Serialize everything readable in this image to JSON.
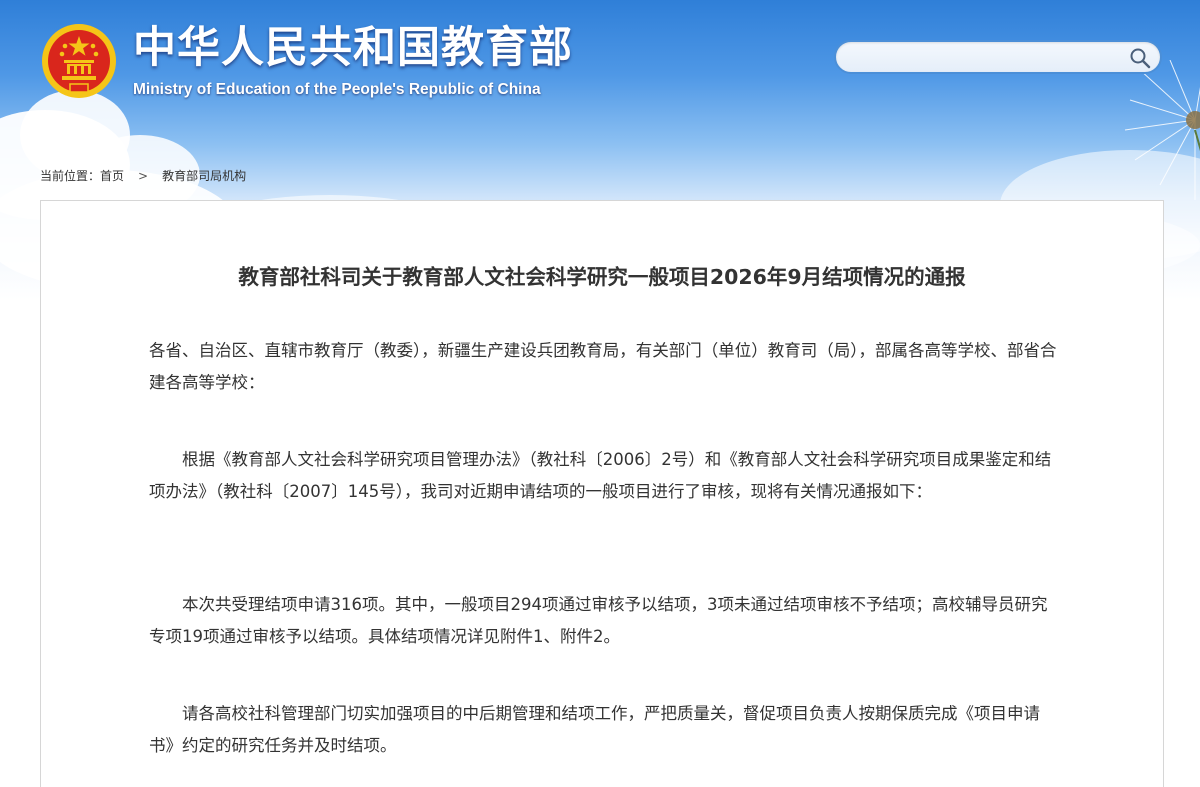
{
  "header": {
    "title": "中华人民共和国教育部",
    "subtitle": "Ministry of Education of the People's Republic of China",
    "emblem_icon": "national-emblem-icon",
    "search": {
      "value": "",
      "placeholder": "",
      "icon": "search-icon"
    }
  },
  "breadcrumb": {
    "prefix": "当前位置：",
    "home": "首页",
    "separator": ">",
    "current": "教育部司局机构"
  },
  "article": {
    "title": "教育部社科司关于教育部人文社会科学研究一般项目2026年9月结项情况的通报",
    "paragraphs": [
      "各省、自治区、直辖市教育厅（教委），新疆生产建设兵团教育局，有关部门（单位）教育司（局），部属各高等学校、部省合建各高等学校：",
      "根据《教育部人文社会科学研究项目管理办法》（教社科〔2006〕2号）和《教育部人文社会科学研究项目成果鉴定和结项办法》（教社科〔2007〕145号），我司对近期申请结项的一般项目进行了审核，现将有关情况通报如下：",
      "本次共受理结项申请316项。其中，一般项目294项通过审核予以结项，3项未通过结项审核不予结项；高校辅导员研究专项19项通过审核予以结项。具体结项情况详见附件1、附件2。",
      "请各高校社科管理部门切实加强项目的中后期管理和结项工作，严把质量关，督促项目负责人按期保质完成《项目申请书》约定的研究任务并及时结项。"
    ]
  },
  "colors": {
    "header_blue": "#2f7fd8",
    "text": "#333333",
    "emblem_red": "#d9261c",
    "emblem_gold": "#f5c518",
    "border": "#d6d6d6"
  }
}
